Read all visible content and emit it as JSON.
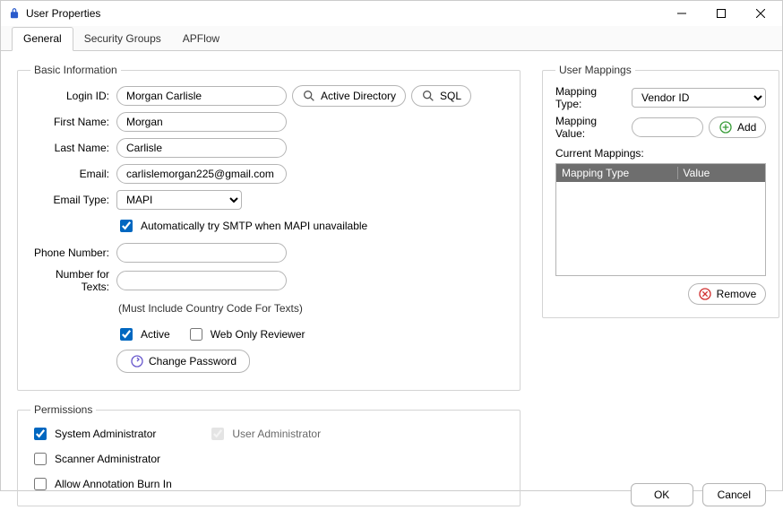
{
  "window": {
    "title": "User Properties"
  },
  "tabs": {
    "general": "General",
    "security": "Security Groups",
    "apflow": "APFlow"
  },
  "basic": {
    "legend": "Basic Information",
    "labels": {
      "login_id": "Login ID:",
      "first_name": "First Name:",
      "last_name": "Last Name:",
      "email": "Email:",
      "email_type": "Email Type:",
      "phone": "Phone Number:",
      "texts": "Number for Texts:"
    },
    "values": {
      "login_id": "Morgan Carlisle",
      "first_name": "Morgan",
      "last_name": "Carlisle",
      "email": "carlislemorgan225@gmail.com",
      "email_type": "MAPI",
      "phone": "",
      "texts": ""
    },
    "ad_btn": "Active Directory",
    "sql_btn": "SQL",
    "smtp_fallback": "Automatically try SMTP when MAPI unavailable",
    "texts_hint": "(Must Include Country Code For Texts)",
    "active": "Active",
    "web_only": "Web Only Reviewer",
    "change_pw": "Change Password"
  },
  "mappings": {
    "legend": "User Mappings",
    "type_label": "Mapping Type:",
    "type_value": "Vendor ID",
    "value_label": "Mapping Value:",
    "add_btn": "Add",
    "current_label": "Current Mappings:",
    "col_type": "Mapping Type",
    "col_value": "Value",
    "remove_btn": "Remove"
  },
  "perm": {
    "legend": "Permissions",
    "sys_admin": "System Administrator",
    "user_admin": "User Administrator",
    "scanner_admin": "Scanner Administrator",
    "allow_burn": "Allow Annotation Burn In"
  },
  "footer": {
    "ok": "OK",
    "cancel": "Cancel"
  }
}
